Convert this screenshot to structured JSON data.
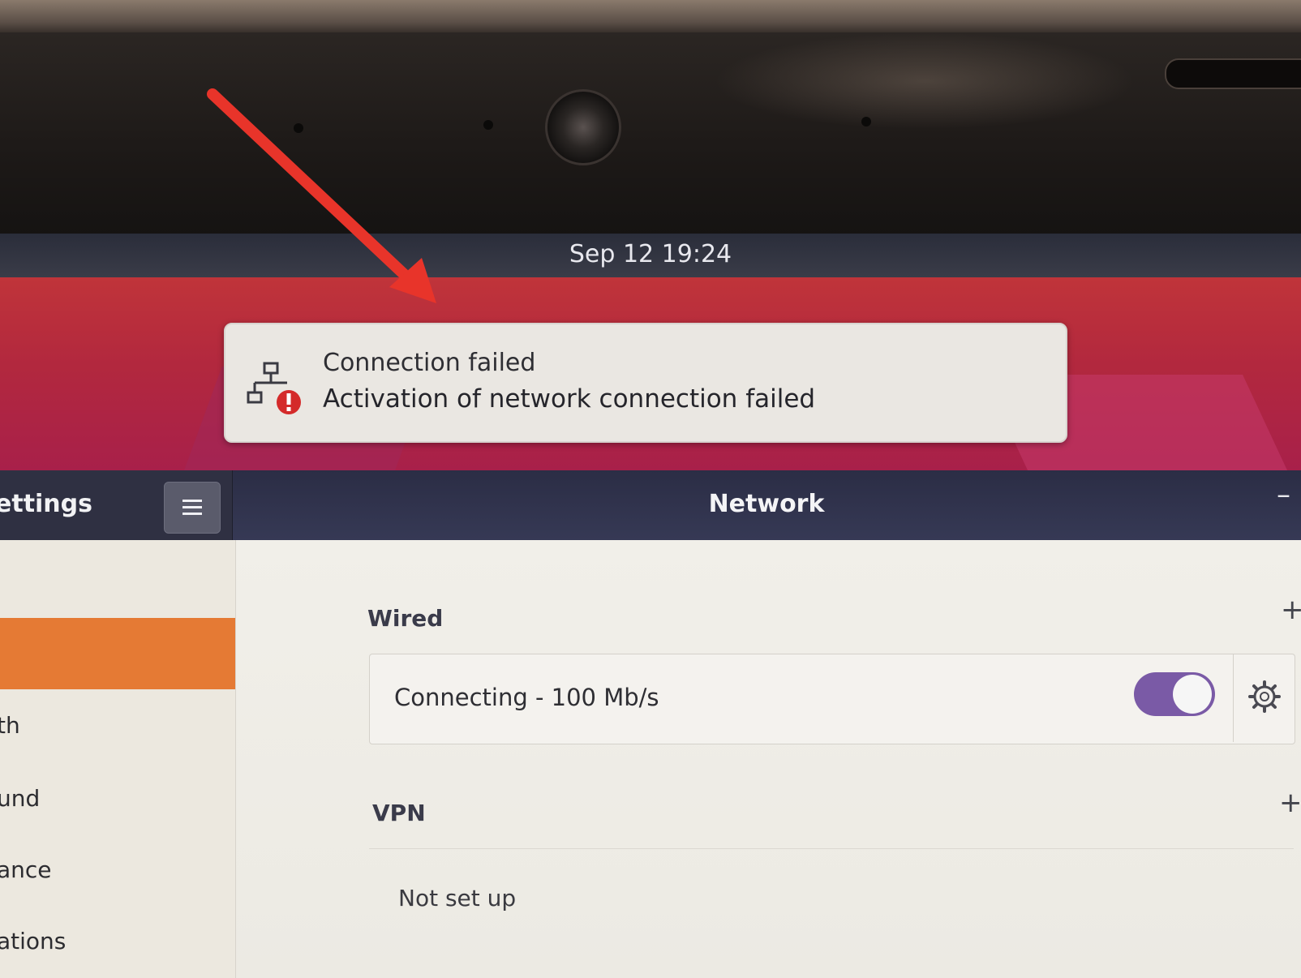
{
  "topbar": {
    "clock": "Sep 12  19:24"
  },
  "notification": {
    "title": "Connection failed",
    "body": "Activation of network connection failed",
    "icon": "network-error-icon"
  },
  "window": {
    "sidebar_title": "ettings",
    "page_title": "Network",
    "minimize_label": "–"
  },
  "sidebar": {
    "items": [
      "th",
      "und",
      "ance",
      "ations"
    ]
  },
  "network": {
    "wired": {
      "label": "Wired",
      "add_label": "+",
      "status": "Connecting - 100 Mb/s",
      "enabled": true
    },
    "vpn": {
      "label": "VPN",
      "add_label": "+",
      "status": "Not set up"
    }
  },
  "colors": {
    "accent": "#e57a34",
    "toggle": "#7a5aa6",
    "annotation_arrow": "#e8342a",
    "error": "#d42a2a"
  }
}
